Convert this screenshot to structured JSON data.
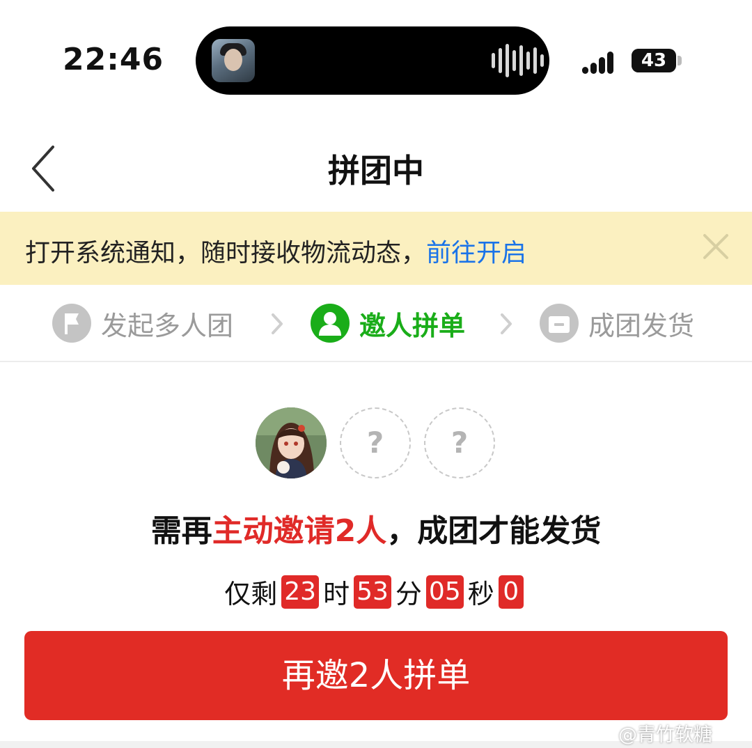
{
  "status_bar": {
    "time": "22:46",
    "battery": "43",
    "battery_level": 43
  },
  "nav": {
    "title": "拼团中",
    "back_icon": "chevron-left-icon"
  },
  "notice": {
    "text": "打开系统通知，随时接收物流动态，",
    "link": "前往开启",
    "close_icon": "close-icon"
  },
  "steps": [
    {
      "label": "发起多人团",
      "icon": "flag-icon",
      "state": "done"
    },
    {
      "label": "邀人拼单",
      "icon": "person-icon",
      "state": "active"
    },
    {
      "label": "成团发货",
      "icon": "package-icon",
      "state": "pending"
    }
  ],
  "members": {
    "placeholder": "?"
  },
  "headline": {
    "prefix": "需再",
    "highlight": "主动邀请2人",
    "suffix": "，成团才能发货"
  },
  "countdown": {
    "prefix": "仅剩",
    "hours": "23",
    "hours_unit": "时",
    "minutes": "53",
    "minutes_unit": "分",
    "seconds": "05",
    "seconds_unit": "秒",
    "tenths": "0"
  },
  "cta": {
    "label": "再邀2人拼单"
  },
  "watermark": "@青竹软糖",
  "colors": {
    "accent_red": "#e12c25",
    "active_green": "#1aad19",
    "link_blue": "#1a73e8",
    "notice_bg": "#fbf0c0"
  }
}
